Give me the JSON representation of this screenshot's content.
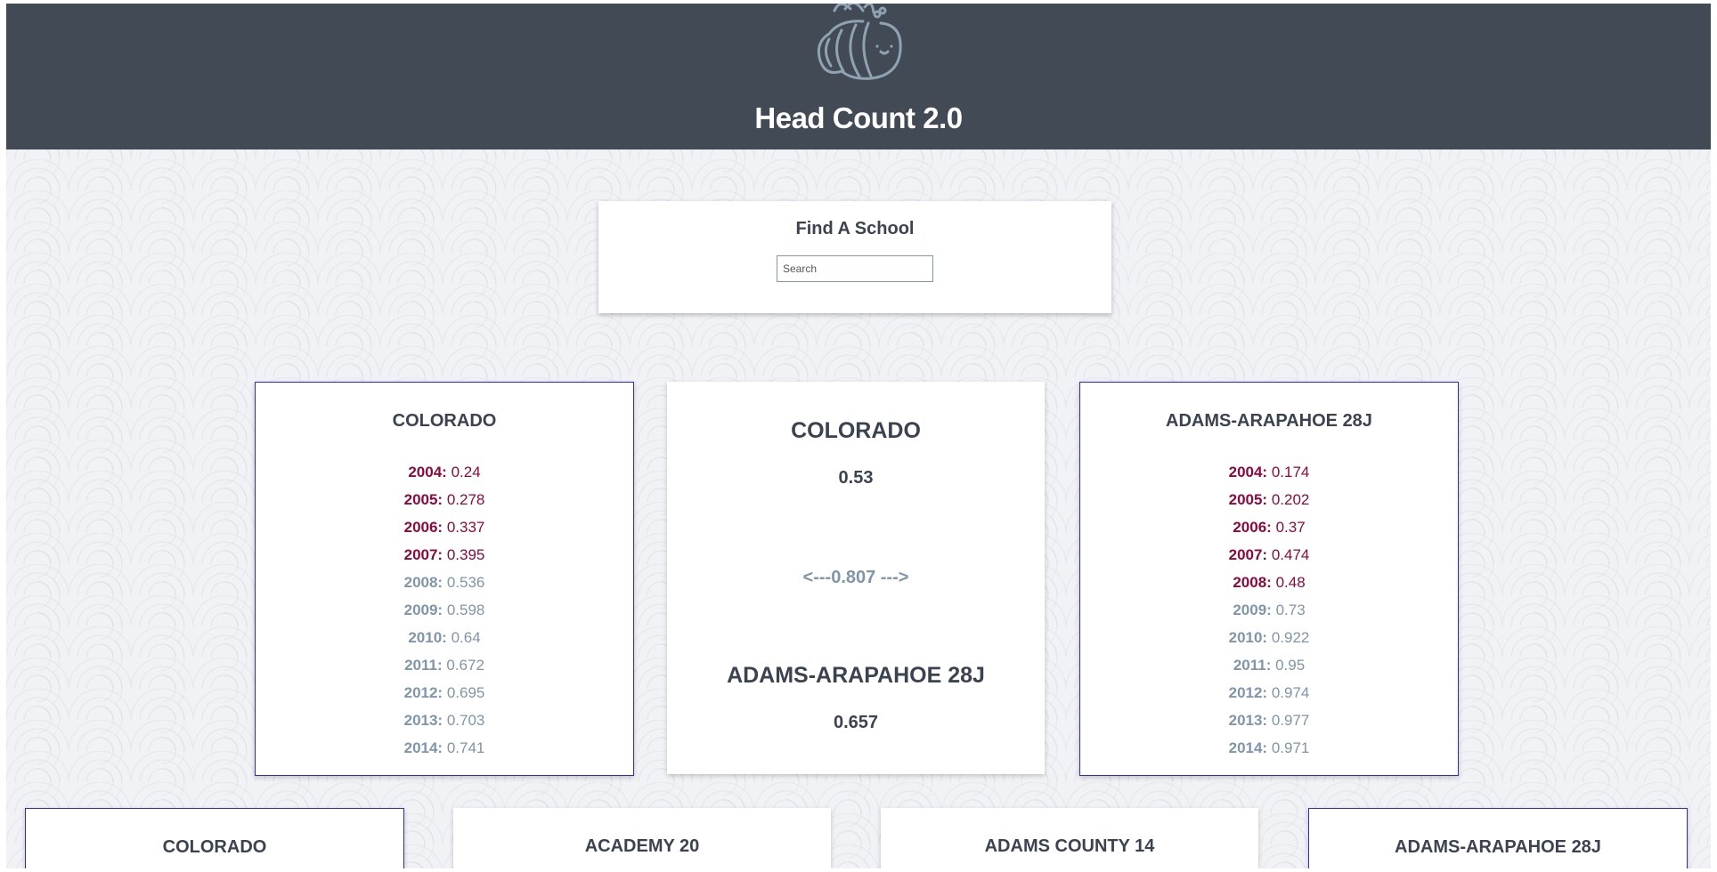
{
  "app": {
    "title": "Head Count 2.0"
  },
  "search": {
    "title": "Find A School",
    "placeholder": "Search"
  },
  "selected": [
    {
      "name": "COLORADO",
      "years": [
        {
          "year": "2004:",
          "value": "0.24",
          "level": "low"
        },
        {
          "year": "2005:",
          "value": "0.278",
          "level": "low"
        },
        {
          "year": "2006:",
          "value": "0.337",
          "level": "low"
        },
        {
          "year": "2007:",
          "value": "0.395",
          "level": "low"
        },
        {
          "year": "2008:",
          "value": "0.536",
          "level": "high"
        },
        {
          "year": "2009:",
          "value": "0.598",
          "level": "high"
        },
        {
          "year": "2010:",
          "value": "0.64",
          "level": "high"
        },
        {
          "year": "2011:",
          "value": "0.672",
          "level": "high"
        },
        {
          "year": "2012:",
          "value": "0.695",
          "level": "high"
        },
        {
          "year": "2013:",
          "value": "0.703",
          "level": "high"
        },
        {
          "year": "2014:",
          "value": "0.741",
          "level": "high"
        }
      ]
    },
    {
      "name": "ADAMS-ARAPAHOE 28J",
      "years": [
        {
          "year": "2004:",
          "value": "0.174",
          "level": "low"
        },
        {
          "year": "2005:",
          "value": "0.202",
          "level": "low"
        },
        {
          "year": "2006:",
          "value": "0.37",
          "level": "low"
        },
        {
          "year": "2007:",
          "value": "0.474",
          "level": "low"
        },
        {
          "year": "2008:",
          "value": "0.48",
          "level": "low"
        },
        {
          "year": "2009:",
          "value": "0.73",
          "level": "high"
        },
        {
          "year": "2010:",
          "value": "0.922",
          "level": "high"
        },
        {
          "year": "2011:",
          "value": "0.95",
          "level": "high"
        },
        {
          "year": "2012:",
          "value": "0.974",
          "level": "high"
        },
        {
          "year": "2013:",
          "value": "0.977",
          "level": "high"
        },
        {
          "year": "2014:",
          "value": "0.971",
          "level": "high"
        }
      ]
    }
  ],
  "comparison": {
    "first_name": "COLORADO",
    "first_value": "0.53",
    "ratio": "<---0.807 --->",
    "second_name": "ADAMS-ARAPAHOE 28J",
    "second_value": "0.657"
  },
  "district_list": [
    {
      "name": "COLORADO",
      "selected": true
    },
    {
      "name": "ACADEMY 20",
      "selected": false
    },
    {
      "name": "ADAMS COUNTY 14",
      "selected": false
    },
    {
      "name": "ADAMS-ARAPAHOE 28J",
      "selected": true
    }
  ],
  "colors": {
    "header_bg": "#424a55",
    "below_threshold": "#8b0a3e",
    "above_threshold": "#7f95aa",
    "selected_border": "#2c2ad8"
  }
}
